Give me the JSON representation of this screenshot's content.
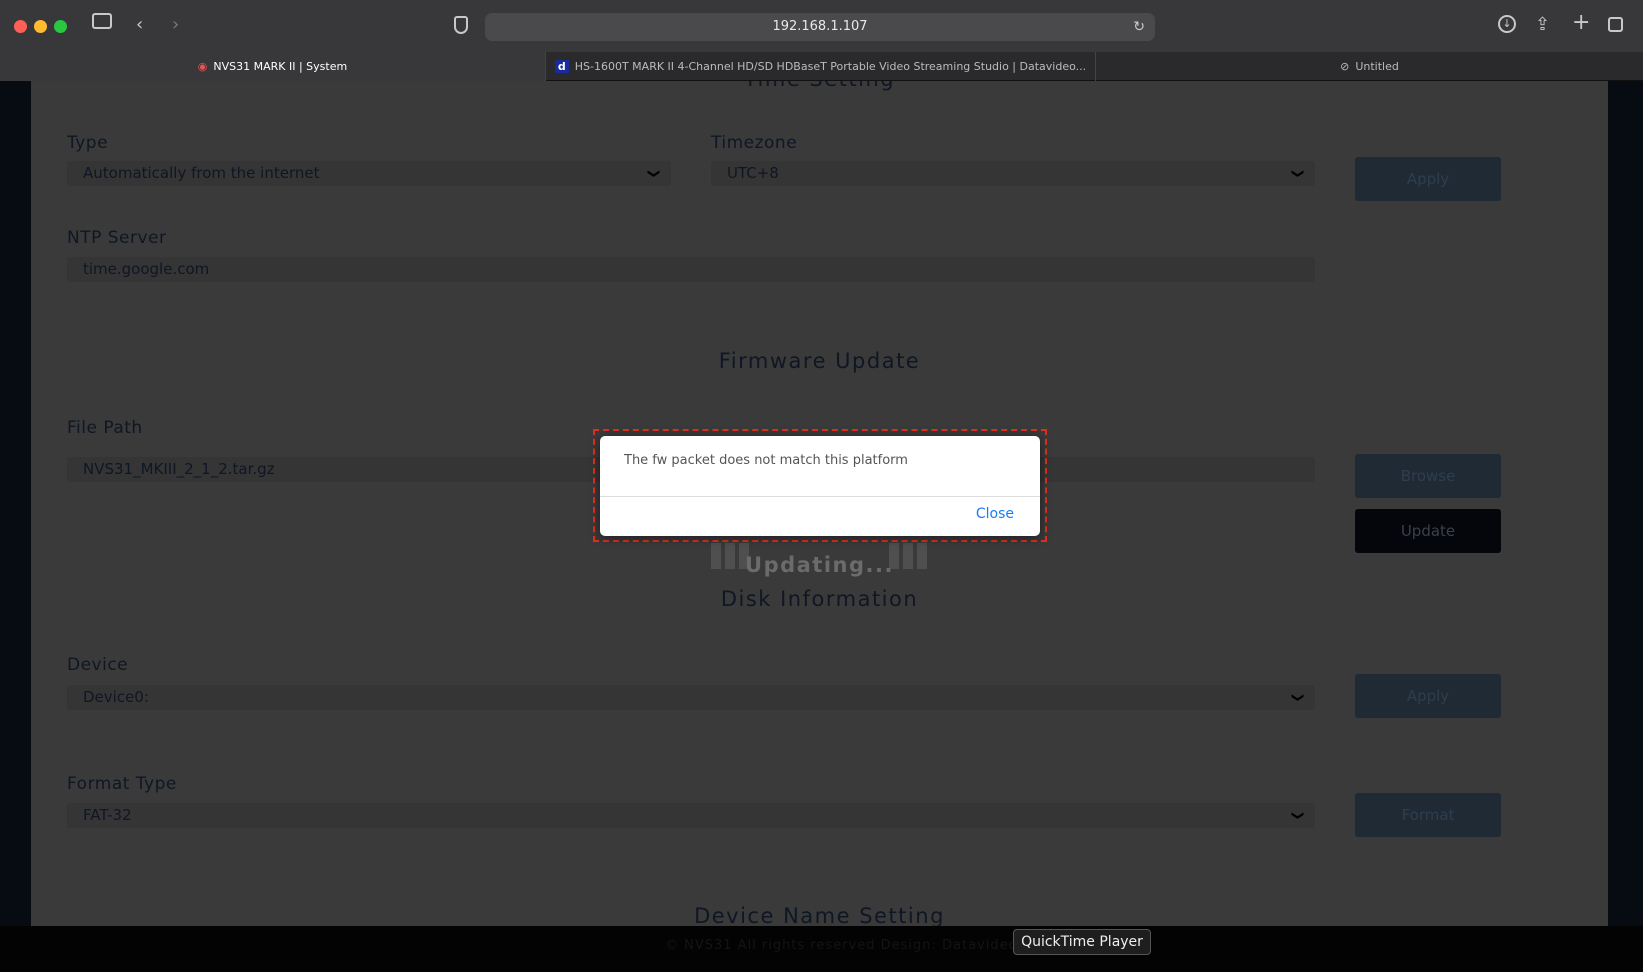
{
  "browser": {
    "url": "192.168.1.107",
    "tabs": [
      {
        "label": "NVS31 MARK II | System",
        "active": true
      },
      {
        "label": "HS-1600T MARK II 4-Channel HD/SD HDBaseT Portable Video Streaming Studio | Datavideo..."
      },
      {
        "label": "Untitled"
      }
    ]
  },
  "time_setting": {
    "title": "Time Setting",
    "type_label": "Type",
    "type_value": "Automatically from the internet",
    "timezone_label": "Timezone",
    "timezone_value": "UTC+8",
    "apply": "Apply",
    "ntp_label": "NTP Server",
    "ntp_value": "time.google.com"
  },
  "firmware": {
    "title": "Firmware Update",
    "file_label": "File Path",
    "file_value": "NVS31_MKIII_2_1_2.tar.gz",
    "browse": "Browse",
    "update": "Update",
    "updating": "Updating..."
  },
  "disk": {
    "title": "Disk Information",
    "device_label": "Device",
    "device_value": "Device0:",
    "apply": "Apply",
    "format_label": "Format Type",
    "format_value": "FAT-32",
    "format": "Format"
  },
  "device_name": {
    "title": "Device Name Setting"
  },
  "footer": {
    "copyright": "© NVS31 All rights reserved Design: Datavideo"
  },
  "dialog": {
    "message": "The fw packet does not match this platform",
    "close": "Close",
    "highlight_color": "#e0301e"
  },
  "dock_tooltip": "QuickTime Player"
}
